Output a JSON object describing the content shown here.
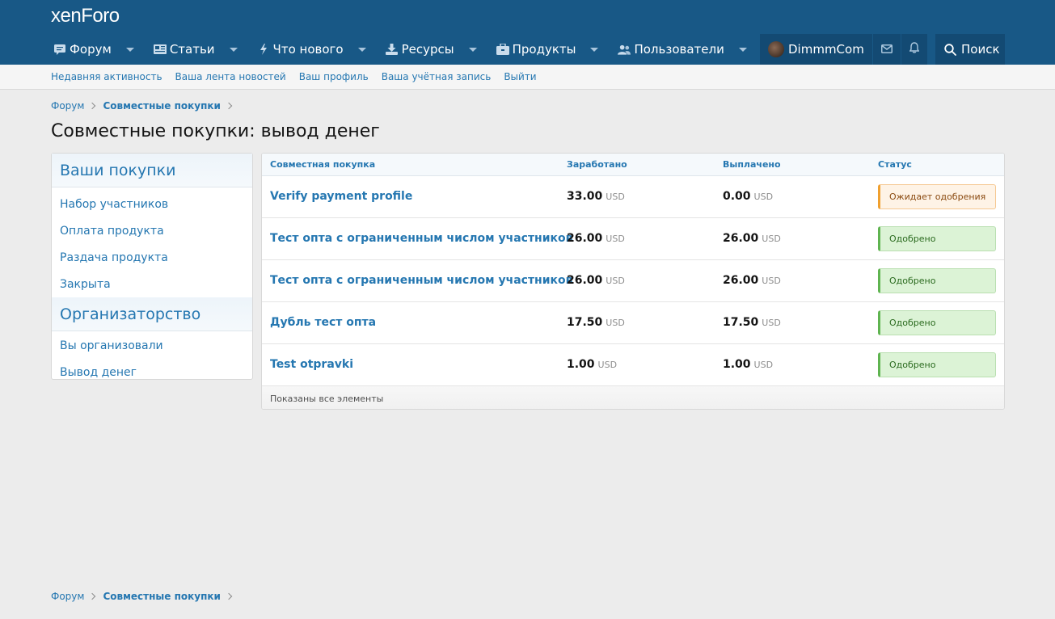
{
  "header": {
    "logo_left": "xen",
    "logo_right": "Foro"
  },
  "nav": {
    "items": [
      {
        "label": "Форум",
        "icon": "forum-icon"
      },
      {
        "label": "Статьи",
        "icon": "articles-icon"
      },
      {
        "label": "Что нового",
        "icon": "bolt-icon"
      },
      {
        "label": "Ресурсы",
        "icon": "download-icon"
      },
      {
        "label": "Продукты",
        "icon": "briefcase-icon"
      },
      {
        "label": "Пользователи",
        "icon": "users-icon"
      }
    ],
    "username": "DimmmCom",
    "search_label": "Поиск"
  },
  "subnav": {
    "items": [
      "Недавняя активность",
      "Ваша лента новостей",
      "Ваш профиль",
      "Ваша учётная запись",
      "Выйти"
    ]
  },
  "breadcrumb": {
    "root": "Форум",
    "current": "Совместные покупки"
  },
  "page_title": "Совместные покупки: вывод денег",
  "sidebar": {
    "section1_title": "Ваши покупки",
    "section1_items": [
      "Набор участников",
      "Оплата продукта",
      "Раздача продукта",
      "Закрыта"
    ],
    "section2_title": "Организаторство",
    "section2_items": [
      "Вы организовали",
      "Вывод денег"
    ]
  },
  "table": {
    "columns": [
      "Совместная покупка",
      "Заработано",
      "Выплачено",
      "Статус"
    ],
    "currency": "USD",
    "rows": [
      {
        "title": "Verify payment profile",
        "earned": "33.00",
        "paid": "0.00",
        "status": "Ожидает одобрения",
        "status_type": "pending"
      },
      {
        "title": "Тест опта с ограниченным числом участников",
        "earned": "26.00",
        "paid": "26.00",
        "status": "Одобрено",
        "status_type": "ok"
      },
      {
        "title": "Тест опта с ограниченным числом участников",
        "earned": "26.00",
        "paid": "26.00",
        "status": "Одобрено",
        "status_type": "ok"
      },
      {
        "title": "Дубль тест опта",
        "earned": "17.50",
        "paid": "17.50",
        "status": "Одобрено",
        "status_type": "ok"
      },
      {
        "title": "Test otpravki",
        "earned": "1.00",
        "paid": "1.00",
        "status": "Одобрено",
        "status_type": "ok"
      }
    ],
    "footer": "Показаны все элементы"
  }
}
